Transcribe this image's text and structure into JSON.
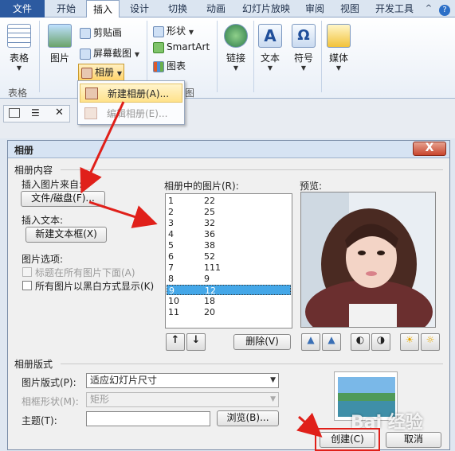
{
  "ribbon": {
    "tabs": [
      "文件",
      "开始",
      "插入",
      "设计",
      "切换",
      "动画",
      "幻灯片放映",
      "审阅",
      "视图",
      "开发工具"
    ],
    "groups": {
      "table": {
        "button": "表格",
        "group_label": "表格"
      },
      "images": {
        "picture": "图片",
        "clip_art": "剪贴画",
        "screenshot": "屏幕截图",
        "album": "相册",
        "group_label": "图"
      },
      "illustrations": {
        "shapes": "形状",
        "smartart": "SmartArt",
        "chart": "图表"
      },
      "links": {
        "label": "链接"
      },
      "text": {
        "label": "文本"
      },
      "symbols": {
        "label": "符号"
      },
      "media": {
        "label": "媒体"
      }
    }
  },
  "album_menu": {
    "new_album": "新建相册(A)...",
    "edit_album": "编辑相册(E)..."
  },
  "dialog": {
    "title": "相册",
    "close": "X",
    "content_section": "相册内容",
    "insert_from": "插入图片来自:",
    "file_disk_button": "文件/磁盘(F)...",
    "insert_text": "插入文本:",
    "new_textbox_button": "新建文本框(X)",
    "picture_options": "图片选项:",
    "caption_below": "标题在所有图片下面(A)",
    "black_white": "所有图片以黑白方式显示(K)",
    "pictures_in_album": "相册中的图片(R):",
    "preview": "预览:",
    "pictures": [
      {
        "no": "1",
        "name": "22"
      },
      {
        "no": "2",
        "name": "25"
      },
      {
        "no": "3",
        "name": "32"
      },
      {
        "no": "4",
        "name": "36"
      },
      {
        "no": "5",
        "name": "38"
      },
      {
        "no": "6",
        "name": "52"
      },
      {
        "no": "7",
        "name": "111"
      },
      {
        "no": "8",
        "name": "9"
      },
      {
        "no": "9",
        "name": "12"
      },
      {
        "no": "10",
        "name": "18"
      },
      {
        "no": "11",
        "name": "20"
      }
    ],
    "selected_index": 8,
    "delete_button": "删除(V)",
    "layout_section": "相册版式",
    "picture_layout_label": "图片版式(P):",
    "picture_layout_value": "适应幻灯片尺寸",
    "frame_shape_label": "相框形状(M):",
    "frame_shape_value": "矩形",
    "theme_label": "主题(T):",
    "theme_value": "",
    "browse_button": "浏览(B)...",
    "create_button": "创建(C)",
    "cancel_button": "取消"
  },
  "watermark": "Bai 经验",
  "colors": {
    "accent": "#2c5aa0",
    "selection": "#44a7e8",
    "highlight_red": "#e0201a"
  }
}
